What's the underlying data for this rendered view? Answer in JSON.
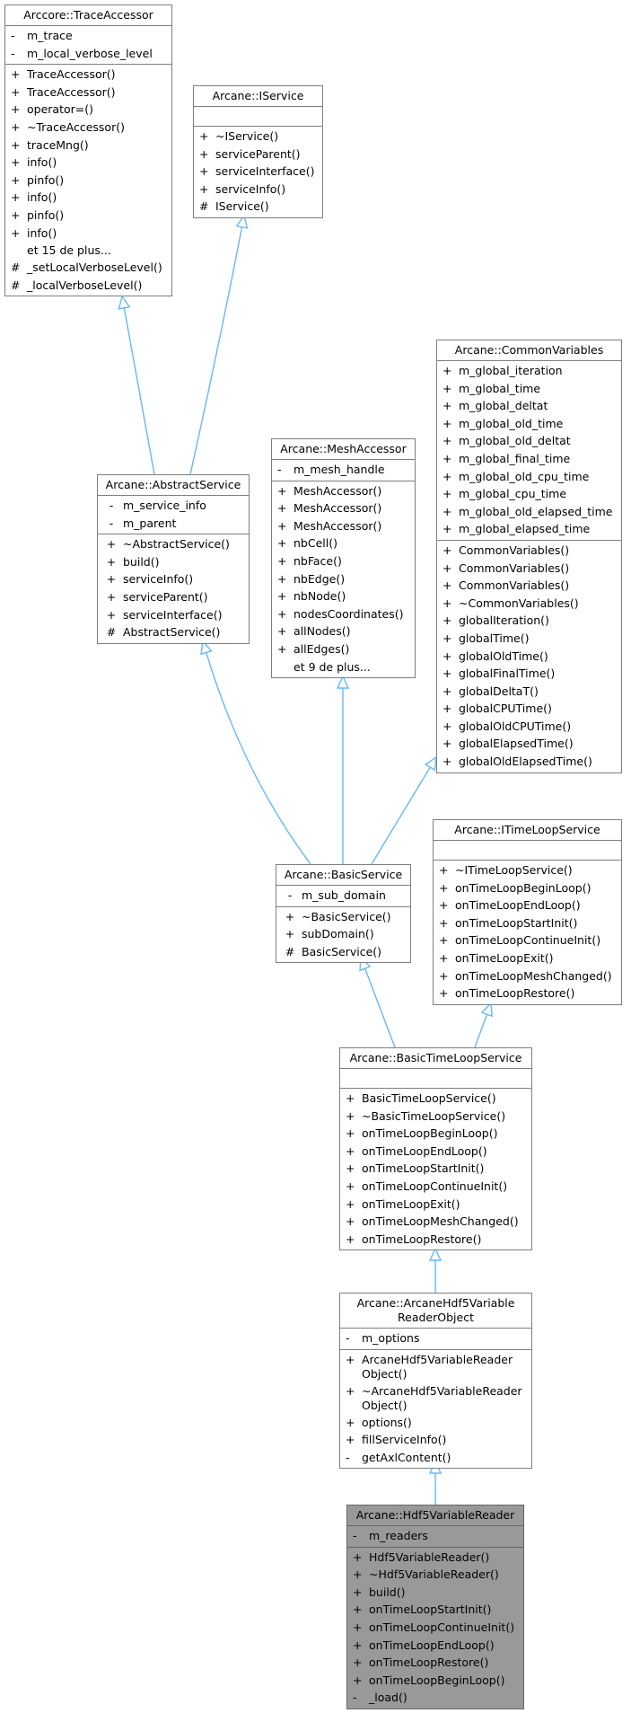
{
  "diagram": {
    "type": "class-inheritance-graph",
    "focus_class": "Arcane::Hdf5VariableReader",
    "colors": {
      "edge": "#63b8ff",
      "border": "#7f7f7f",
      "focus_fill": "#999999",
      "fill": "#ffffff"
    },
    "classes": [
      {
        "id": "trace-accessor",
        "title": "Arccore::TraceAccessor",
        "attributes": [
          {
            "vis": "-",
            "name": "m_trace"
          },
          {
            "vis": "-",
            "name": "m_local_verbose_level"
          }
        ],
        "methods": [
          {
            "vis": "+",
            "name": "TraceAccessor()"
          },
          {
            "vis": "+",
            "name": "TraceAccessor()"
          },
          {
            "vis": "+",
            "name": "operator=()"
          },
          {
            "vis": "+",
            "name": "~TraceAccessor()"
          },
          {
            "vis": "+",
            "name": "traceMng()"
          },
          {
            "vis": "+",
            "name": "info()"
          },
          {
            "vis": "+",
            "name": "pinfo()"
          },
          {
            "vis": "+",
            "name": "info()"
          },
          {
            "vis": "+",
            "name": "pinfo()"
          },
          {
            "vis": "+",
            "name": "info()"
          },
          {
            "vis": "",
            "name": "et 15 de plus..."
          },
          {
            "vis": "#",
            "name": "_setLocalVerboseLevel()"
          },
          {
            "vis": "#",
            "name": "_localVerboseLevel()"
          }
        ]
      },
      {
        "id": "iservice",
        "title": "Arcane::IService",
        "attributes": [],
        "methods": [
          {
            "vis": "+",
            "name": "~IService()"
          },
          {
            "vis": "+",
            "name": "serviceParent()"
          },
          {
            "vis": "+",
            "name": "serviceInterface()"
          },
          {
            "vis": "+",
            "name": "serviceInfo()"
          },
          {
            "vis": "#",
            "name": "IService()"
          }
        ]
      },
      {
        "id": "common-variables",
        "title": "Arcane::CommonVariables",
        "attributes": [
          {
            "vis": "+",
            "name": "m_global_iteration"
          },
          {
            "vis": "+",
            "name": "m_global_time"
          },
          {
            "vis": "+",
            "name": "m_global_deltat"
          },
          {
            "vis": "+",
            "name": "m_global_old_time"
          },
          {
            "vis": "+",
            "name": "m_global_old_deltat"
          },
          {
            "vis": "+",
            "name": "m_global_final_time"
          },
          {
            "vis": "+",
            "name": "m_global_old_cpu_time"
          },
          {
            "vis": "+",
            "name": "m_global_cpu_time"
          },
          {
            "vis": "+",
            "name": "m_global_old_elapsed_time"
          },
          {
            "vis": "+",
            "name": "m_global_elapsed_time"
          }
        ],
        "methods": [
          {
            "vis": "+",
            "name": "CommonVariables()"
          },
          {
            "vis": "+",
            "name": "CommonVariables()"
          },
          {
            "vis": "+",
            "name": "CommonVariables()"
          },
          {
            "vis": "+",
            "name": "~CommonVariables()"
          },
          {
            "vis": "+",
            "name": "globalIteration()"
          },
          {
            "vis": "+",
            "name": "globalTime()"
          },
          {
            "vis": "+",
            "name": "globalOldTime()"
          },
          {
            "vis": "+",
            "name": "globalFinalTime()"
          },
          {
            "vis": "+",
            "name": "globalDeltaT()"
          },
          {
            "vis": "+",
            "name": "globalCPUTime()"
          },
          {
            "vis": "+",
            "name": "globalOldCPUTime()"
          },
          {
            "vis": "+",
            "name": "globalElapsedTime()"
          },
          {
            "vis": "+",
            "name": "globalOldElapsedTime()"
          }
        ]
      },
      {
        "id": "mesh-accessor",
        "title": "Arcane::MeshAccessor",
        "attributes": [
          {
            "vis": "-",
            "name": "m_mesh_handle"
          }
        ],
        "methods": [
          {
            "vis": "+",
            "name": "MeshAccessor()"
          },
          {
            "vis": "+",
            "name": "MeshAccessor()"
          },
          {
            "vis": "+",
            "name": "MeshAccessor()"
          },
          {
            "vis": "+",
            "name": "nbCell()"
          },
          {
            "vis": "+",
            "name": "nbFace()"
          },
          {
            "vis": "+",
            "name": "nbEdge()"
          },
          {
            "vis": "+",
            "name": "nbNode()"
          },
          {
            "vis": "+",
            "name": "nodesCoordinates()"
          },
          {
            "vis": "+",
            "name": "allNodes()"
          },
          {
            "vis": "+",
            "name": "allEdges()"
          },
          {
            "vis": "",
            "name": "et 9 de plus..."
          }
        ]
      },
      {
        "id": "abstract-service",
        "title": "Arcane::AbstractService",
        "attributes": [
          {
            "vis": "-",
            "name": "m_service_info"
          },
          {
            "vis": "-",
            "name": "m_parent"
          }
        ],
        "methods": [
          {
            "vis": "+",
            "name": "~AbstractService()"
          },
          {
            "vis": "+",
            "name": "build()"
          },
          {
            "vis": "+",
            "name": "serviceInfo()"
          },
          {
            "vis": "+",
            "name": "serviceParent()"
          },
          {
            "vis": "+",
            "name": "serviceInterface()"
          },
          {
            "vis": "#",
            "name": "AbstractService()"
          }
        ]
      },
      {
        "id": "basic-service",
        "title": "Arcane::BasicService",
        "attributes": [
          {
            "vis": "-",
            "name": "m_sub_domain"
          }
        ],
        "methods": [
          {
            "vis": "+",
            "name": "~BasicService()"
          },
          {
            "vis": "+",
            "name": "subDomain()"
          },
          {
            "vis": "#",
            "name": "BasicService()"
          }
        ]
      },
      {
        "id": "itimeloop-service",
        "title": "Arcane::ITimeLoopService",
        "attributes": [],
        "methods": [
          {
            "vis": "+",
            "name": "~ITimeLoopService()"
          },
          {
            "vis": "+",
            "name": "onTimeLoopBeginLoop()"
          },
          {
            "vis": "+",
            "name": "onTimeLoopEndLoop()"
          },
          {
            "vis": "+",
            "name": "onTimeLoopStartInit()"
          },
          {
            "vis": "+",
            "name": "onTimeLoopContinueInit()"
          },
          {
            "vis": "+",
            "name": "onTimeLoopExit()"
          },
          {
            "vis": "+",
            "name": "onTimeLoopMeshChanged()"
          },
          {
            "vis": "+",
            "name": "onTimeLoopRestore()"
          }
        ]
      },
      {
        "id": "basic-timeloop-service",
        "title": "Arcane::BasicTimeLoopService",
        "attributes": [],
        "methods": [
          {
            "vis": "+",
            "name": "BasicTimeLoopService()"
          },
          {
            "vis": "+",
            "name": "~BasicTimeLoopService()"
          },
          {
            "vis": "+",
            "name": "onTimeLoopBeginLoop()"
          },
          {
            "vis": "+",
            "name": "onTimeLoopEndLoop()"
          },
          {
            "vis": "+",
            "name": "onTimeLoopStartInit()"
          },
          {
            "vis": "+",
            "name": "onTimeLoopContinueInit()"
          },
          {
            "vis": "+",
            "name": "onTimeLoopExit()"
          },
          {
            "vis": "+",
            "name": "onTimeLoopMeshChanged()"
          },
          {
            "vis": "+",
            "name": "onTimeLoopRestore()"
          }
        ]
      },
      {
        "id": "arcane-hdf5-variable-reader-object",
        "title": "Arcane::ArcaneHdf5Variable\nReaderObject",
        "attributes": [
          {
            "vis": "-",
            "name": "m_options"
          }
        ],
        "methods": [
          {
            "vis": "+",
            "name": "ArcaneHdf5VariableReader\nObject()"
          },
          {
            "vis": "+",
            "name": "~ArcaneHdf5VariableReader\nObject()"
          },
          {
            "vis": "+",
            "name": "options()"
          },
          {
            "vis": "+",
            "name": "fillServiceInfo()"
          },
          {
            "vis": "-",
            "name": "getAxlContent()"
          }
        ]
      },
      {
        "id": "hdf5-variable-reader",
        "title": "Arcane::Hdf5VariableReader",
        "focus": true,
        "attributes": [
          {
            "vis": "-",
            "name": "m_readers"
          }
        ],
        "methods": [
          {
            "vis": "+",
            "name": "Hdf5VariableReader()"
          },
          {
            "vis": "+",
            "name": "~Hdf5VariableReader()"
          },
          {
            "vis": "+",
            "name": "build()"
          },
          {
            "vis": "+",
            "name": "onTimeLoopStartInit()"
          },
          {
            "vis": "+",
            "name": "onTimeLoopContinueInit()"
          },
          {
            "vis": "+",
            "name": "onTimeLoopEndLoop()"
          },
          {
            "vis": "+",
            "name": "onTimeLoopRestore()"
          },
          {
            "vis": "+",
            "name": "onTimeLoopBeginLoop()"
          },
          {
            "vis": "-",
            "name": "_load()"
          }
        ]
      }
    ],
    "inheritance": [
      {
        "child": "abstract-service",
        "parent": "trace-accessor"
      },
      {
        "child": "abstract-service",
        "parent": "iservice"
      },
      {
        "child": "basic-service",
        "parent": "abstract-service"
      },
      {
        "child": "basic-service",
        "parent": "mesh-accessor"
      },
      {
        "child": "basic-service",
        "parent": "common-variables"
      },
      {
        "child": "basic-timeloop-service",
        "parent": "basic-service"
      },
      {
        "child": "basic-timeloop-service",
        "parent": "itimeloop-service"
      },
      {
        "child": "arcane-hdf5-variable-reader-object",
        "parent": "basic-timeloop-service"
      },
      {
        "child": "hdf5-variable-reader",
        "parent": "arcane-hdf5-variable-reader-object"
      }
    ]
  }
}
